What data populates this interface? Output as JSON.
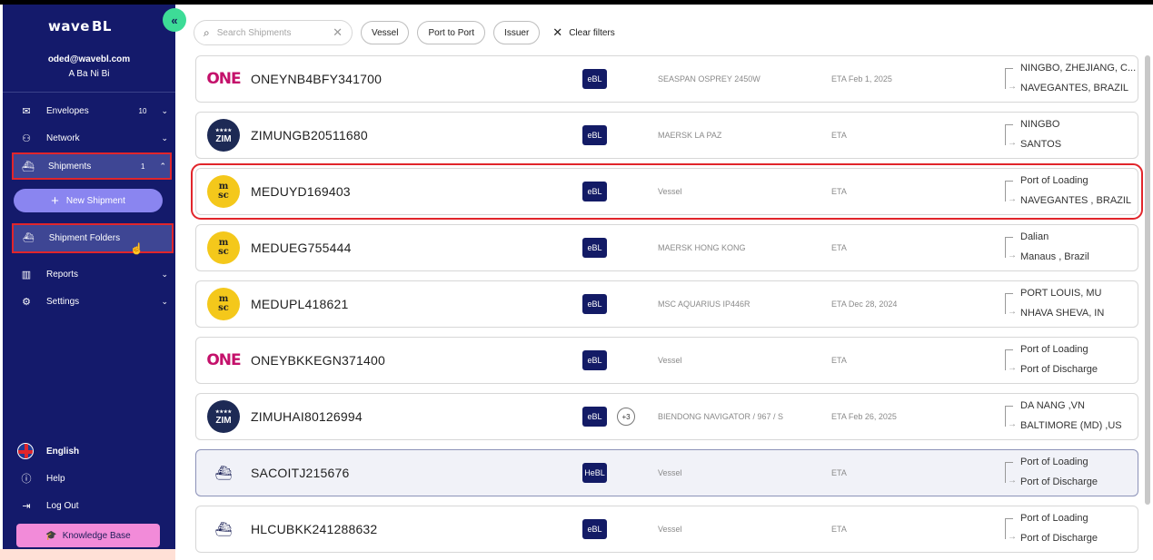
{
  "app": {
    "logo_main": "wave",
    "logo_suffix": "BL",
    "collapse_icon": "«"
  },
  "user": {
    "email": "oded@wavebl.com",
    "name": "A Ba Ni Bi"
  },
  "nav": {
    "envelopes": {
      "label": "Envelopes",
      "count": "10"
    },
    "network": {
      "label": "Network"
    },
    "shipments": {
      "label": "Shipments",
      "count": "1"
    },
    "new_shipment": "New Shipment",
    "shipment_folders": "Shipment Folders",
    "reports": {
      "label": "Reports"
    },
    "settings": {
      "label": "Settings"
    },
    "language": "English",
    "help": "Help",
    "logout": "Log Out",
    "knowledge_base": "Knowledge Base"
  },
  "filters": {
    "search_placeholder": "Search Shipments",
    "chips": [
      "Vessel",
      "Port to Port",
      "Issuer"
    ],
    "clear": "Clear filters"
  },
  "colors": {
    "sidebar": "#141a6b",
    "accent_green": "#3ddc97",
    "badge": "#131b66",
    "highlight": "#e1252b"
  },
  "shipments": [
    {
      "carrier": "ONE",
      "ref": "ONEYNB4BFY341700",
      "badge": "eBL",
      "vessel": "SEASPAN OSPREY 2450W",
      "eta": "ETA Feb 1, 2025",
      "from": "NINGBO, ZHEJIANG, C...",
      "to": "NAVEGANTES, BRAZIL"
    },
    {
      "carrier": "ZIM",
      "ref": "ZIMUNGB20511680",
      "badge": "eBL",
      "vessel": "MAERSK LA PAZ",
      "eta": "ETA",
      "from": "NINGBO",
      "to": "SANTOS"
    },
    {
      "carrier": "MSC",
      "ref": "MEDUYD169403",
      "badge": "eBL",
      "vessel": "Vessel",
      "eta": "ETA",
      "from": "Port of Loading",
      "to": "NAVEGANTES , BRAZIL"
    },
    {
      "carrier": "MSC",
      "ref": "MEDUEG755444",
      "badge": "eBL",
      "vessel": "MAERSK HONG KONG",
      "eta": "ETA",
      "from": "Dalian",
      "to": "Manaus , Brazil"
    },
    {
      "carrier": "MSC",
      "ref": "MEDUPL418621",
      "badge": "eBL",
      "vessel": "MSC AQUARIUS IP446R",
      "eta": "ETA Dec 28, 2024",
      "from": "PORT LOUIS, MU",
      "to": "NHAVA SHEVA, IN"
    },
    {
      "carrier": "ONE",
      "ref": "ONEYBKKEGN371400",
      "badge": "eBL",
      "vessel": "Vessel",
      "eta": "ETA",
      "from": "Port of Loading",
      "to": "Port of Discharge"
    },
    {
      "carrier": "ZIM",
      "ref": "ZIMUHAI80126994",
      "badge": "eBL",
      "extra": "+3",
      "vessel": "BIENDONG NAVIGATOR / 967 / S",
      "eta": "ETA Feb 26, 2025",
      "from": "DA NANG ,VN",
      "to": "BALTIMORE (MD) ,US"
    },
    {
      "carrier": "SHIP",
      "ref": "SACOITJ215676",
      "badge": "HeBL",
      "vessel": "Vessel",
      "eta": "ETA",
      "from": "Port of Loading",
      "to": "Port of Discharge"
    },
    {
      "carrier": "SHIP",
      "ref": "HLCUBKK241288632",
      "badge": "eBL",
      "vessel": "Vessel",
      "eta": "ETA",
      "from": "Port of Loading",
      "to": "Port of Discharge"
    }
  ]
}
